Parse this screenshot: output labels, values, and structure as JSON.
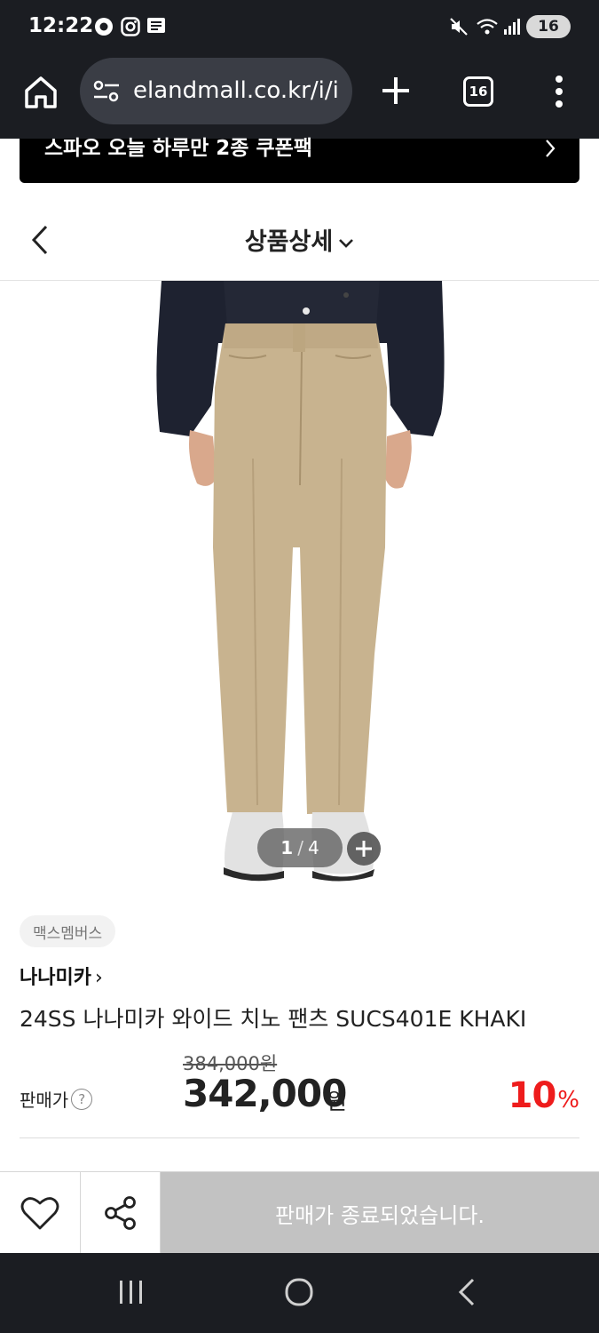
{
  "status_bar": {
    "time": "12:22",
    "battery": "16",
    "icons": [
      "record-icon",
      "instagram-icon",
      "message-icon",
      "mute-icon",
      "wifi-icon",
      "signal-icon"
    ]
  },
  "browser": {
    "url": "elandmall.co.kr/i/i",
    "tab_count": "16",
    "icons": [
      "home-icon",
      "site-settings-icon",
      "new-tab-icon",
      "tabs-icon",
      "menu-icon"
    ]
  },
  "promo_banner": {
    "text": "스파오 오늘 하루만 2종 쿠폰팩"
  },
  "page_header": {
    "title": "상품상세"
  },
  "product": {
    "image_counter_current": "1",
    "image_counter_sep": "/",
    "image_counter_total": "4",
    "badge": "맥스멤버스",
    "brand": "나나미카",
    "brand_arrow": "›",
    "title": "24SS 나나미카 와이드 치노 팬츠 SUCS401E KHAKI",
    "original_price": "384,000원",
    "price_label": "판매가",
    "help_icon": "?",
    "sale_price": "342,000",
    "currency": "원",
    "discount": "10",
    "discount_unit": "%",
    "colors": {
      "pants": "#c8b38f",
      "shirt": "#1e2230",
      "discount": "#ee1c1c"
    }
  },
  "action_bar": {
    "soldout_label": "판매가 종료되었습니다."
  },
  "android_nav": {
    "icons": [
      "recents-icon",
      "home-circle-icon",
      "back-icon"
    ]
  }
}
